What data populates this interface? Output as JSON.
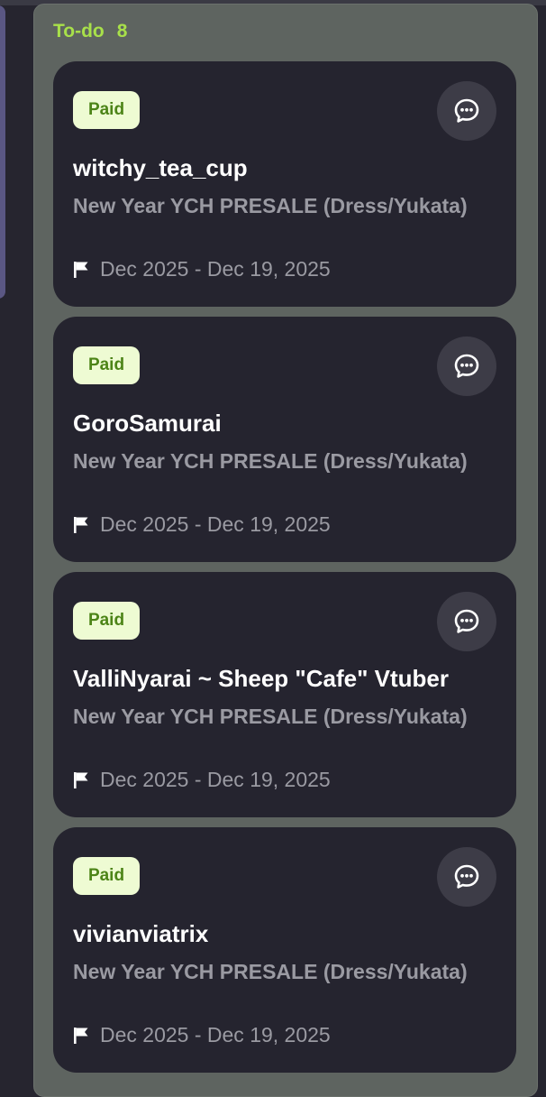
{
  "column": {
    "title": "To-do",
    "count": "8"
  },
  "cards": [
    {
      "badge": "Paid",
      "client": "witchy_tea_cup",
      "item": "New Year YCH PRESALE (Dress/Yukata)",
      "dates": "Dec 2025 - Dec 19, 2025"
    },
    {
      "badge": "Paid",
      "client": "GoroSamurai",
      "item": "New Year YCH PRESALE (Dress/Yukata)",
      "dates": "Dec 2025 - Dec 19, 2025"
    },
    {
      "badge": "Paid",
      "client": "ValliNyarai ~ Sheep \"Cafe\" Vtuber",
      "item": "New Year YCH PRESALE (Dress/Yukata)",
      "dates": "Dec 2025 - Dec 19, 2025"
    },
    {
      "badge": "Paid",
      "client": "vivianviatrix",
      "item": "New Year YCH PRESALE (Dress/Yukata)",
      "dates": "Dec 2025 - Dec 19, 2025"
    }
  ],
  "icons": {
    "chat": "chat-bubble-icon",
    "due": "flag-icon"
  },
  "colors": {
    "column_title": "#a8e04a",
    "badge_bg": "#eefbd3",
    "badge_text": "#4c8417",
    "card_bg": "#25242f",
    "column_bg": "#5e6460"
  }
}
